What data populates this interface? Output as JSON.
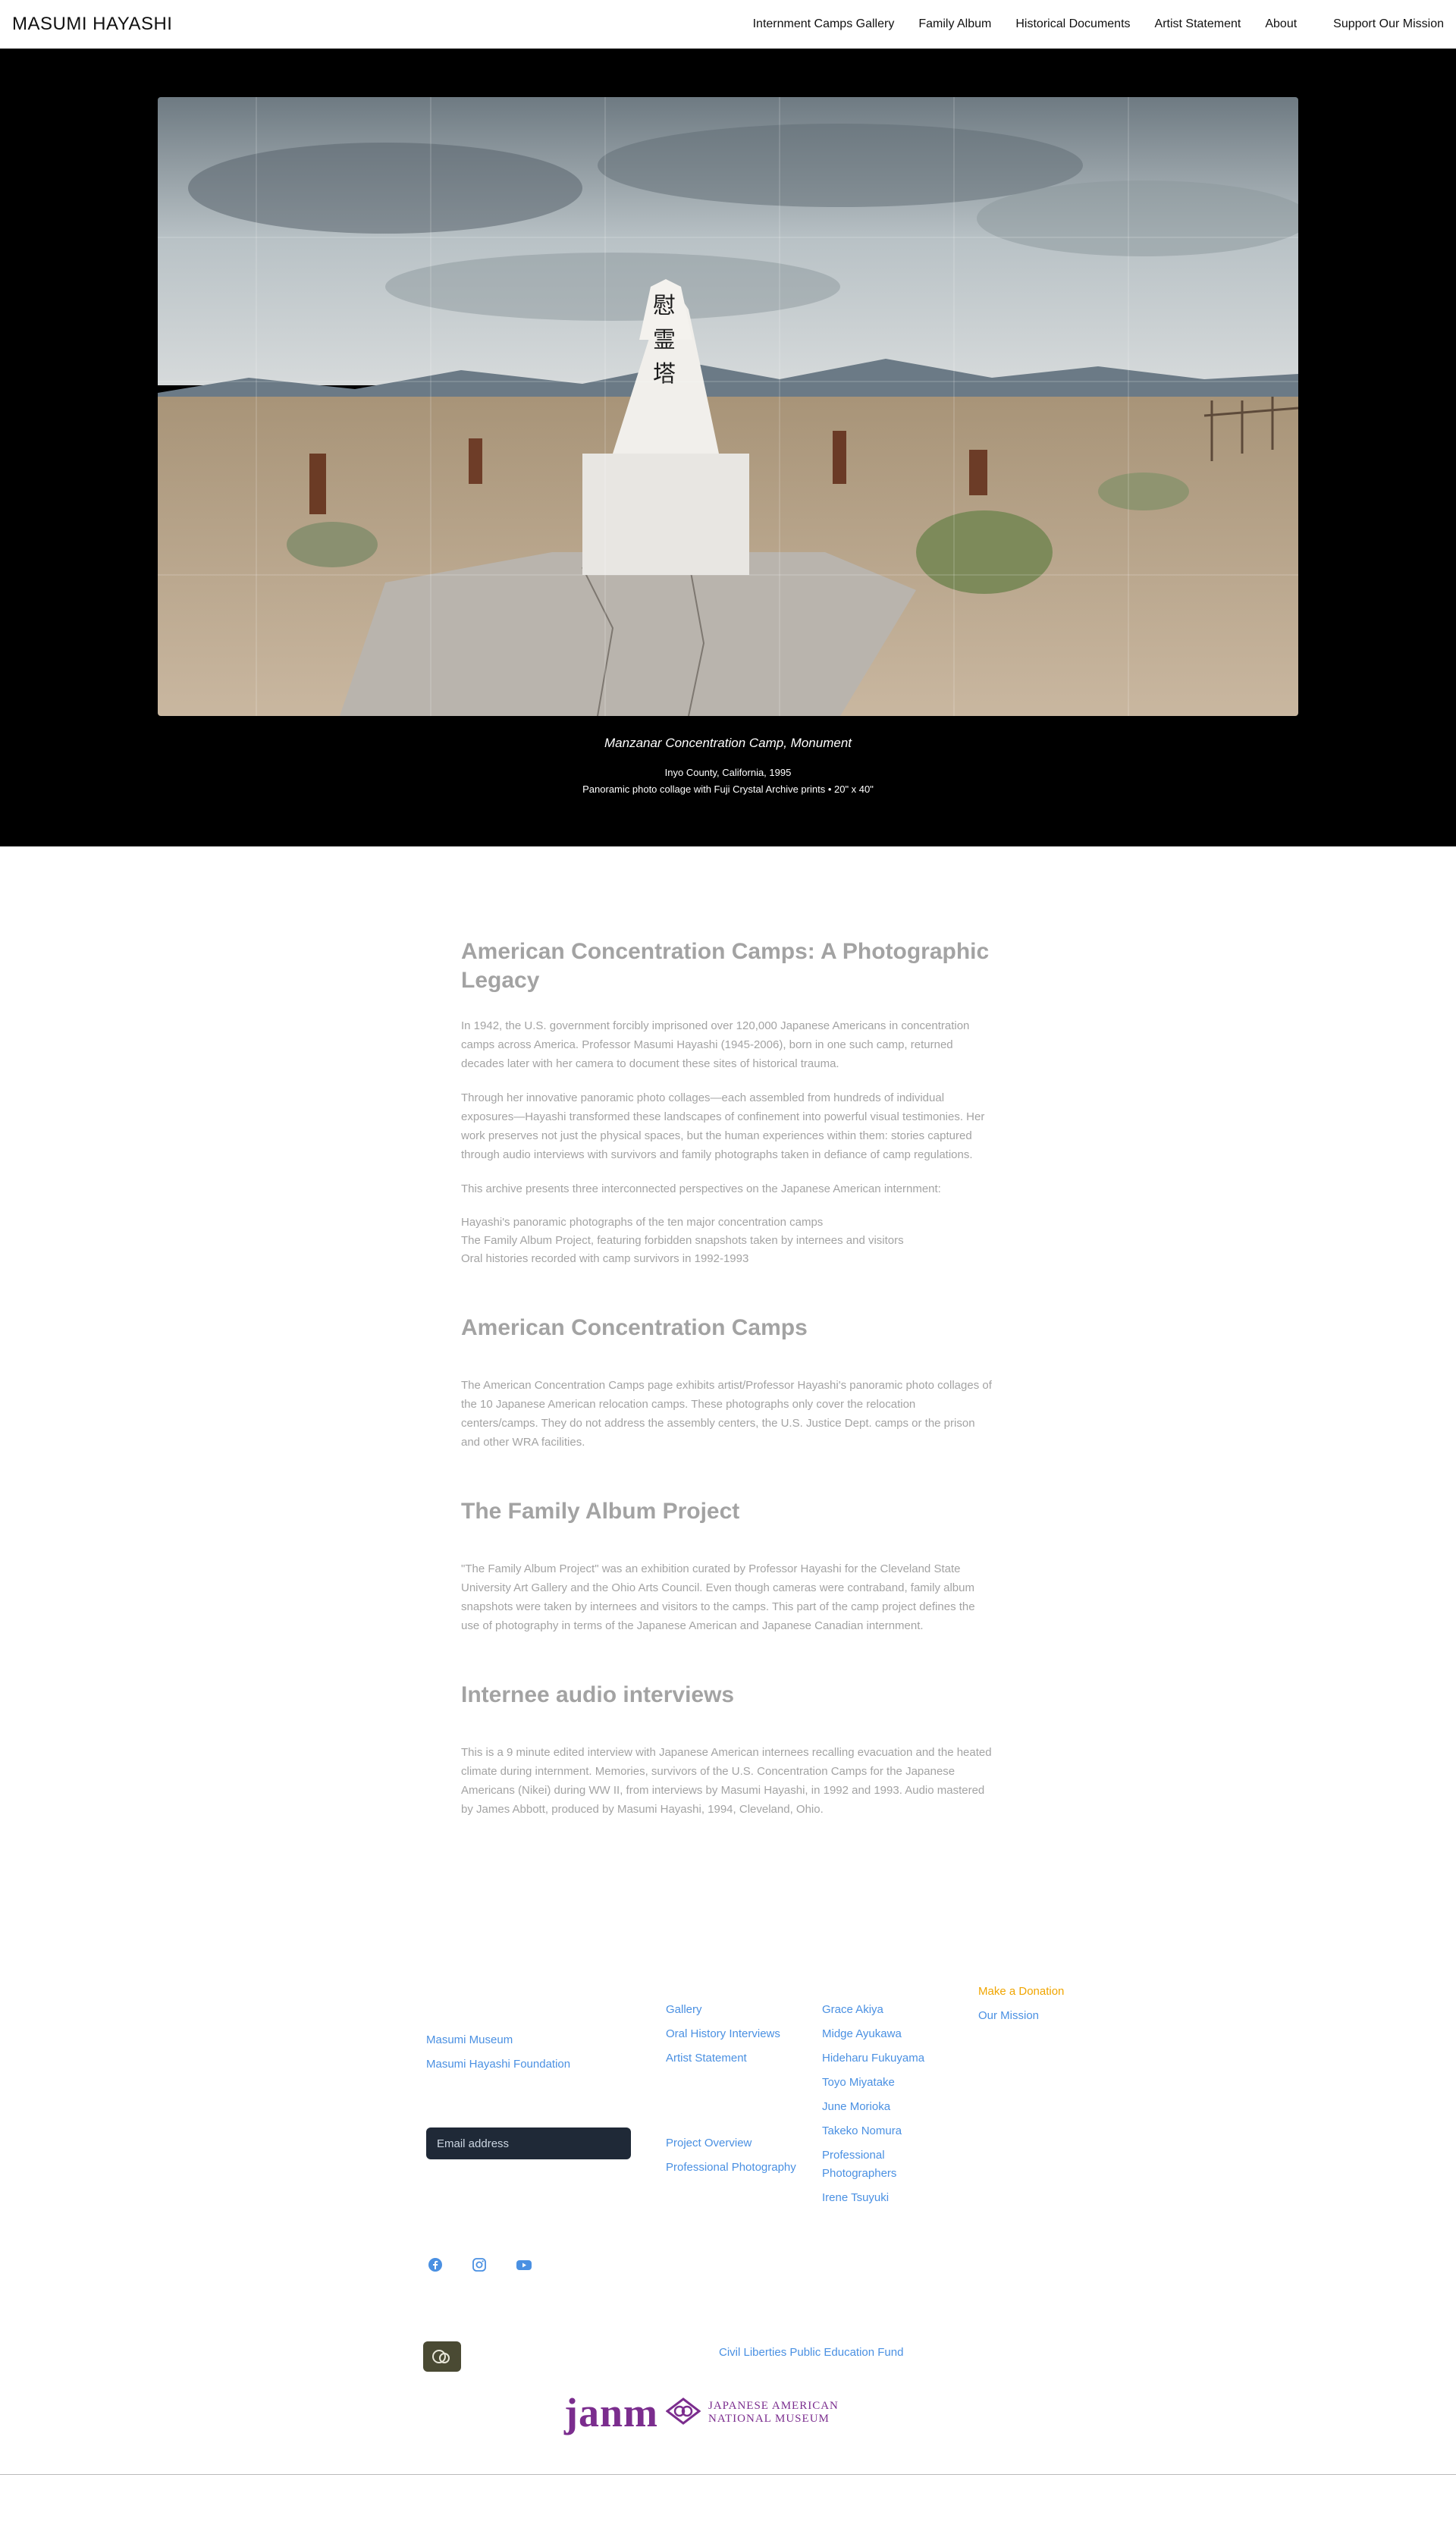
{
  "header": {
    "brand": "MASUMI HAYASHI",
    "nav": [
      "Internment Camps Gallery",
      "Family Album",
      "Historical Documents",
      "Artist Statement",
      "About"
    ],
    "support": "Support Our Mission"
  },
  "hero": {
    "title": "Manzanar Concentration Camp, Monument",
    "location": "Inyo County, California, 1995",
    "medium": "Panoramic photo collage with Fuji Crystal Archive prints • 20\" x 40\"",
    "monument_glyphs": [
      "慰",
      "霊",
      "塔"
    ]
  },
  "content": {
    "intro": {
      "title": "American Concentration Camps: A Photographic Legacy",
      "p1": "In 1942, the U.S. government forcibly imprisoned over 120,000 Japanese Americans in concentration camps across America. Professor Masumi Hayashi (1945-2006), born in one such camp, returned decades later with her camera to document these sites of historical trauma.",
      "p2": "Through her innovative panoramic photo collages—each assembled from hundreds of individual exposures—Hayashi transformed these landscapes of confinement into powerful visual testimonies. Her work preserves not just the physical spaces, but the human experiences within them: stories captured through audio interviews with survivors and family photographs taken in defiance of camp regulations.",
      "p3": "This archive presents three interconnected perspectives on the Japanese American internment:",
      "list": [
        "Hayashi's panoramic photographs of the ten major concentration camps",
        "The Family Album Project, featuring forbidden snapshots taken by internees and visitors",
        "Oral histories recorded with camp survivors in 1992-1993"
      ]
    },
    "camps": {
      "title": "American Concentration Camps",
      "body": "The American Concentration Camps page exhibits artist/Professor Hayashi's panoramic photo collages of the 10 Japanese American relocation camps. These photographs only cover the relocation centers/camps. They do not address the assembly centers, the U.S. Justice Dept. camps or the prison and other WRA facilities."
    },
    "album": {
      "title": "The Family Album Project",
      "body": "\"The Family Album Project\" was an exhibition curated by Professor Hayashi for the Cleveland State University Art Gallery and the Ohio Arts Council. Even though cameras were contraband, family album snapshots were taken by internees and visitors to the camps. This part of the camp project defines the use of photography in terms of the Japanese American and Japanese Canadian internment."
    },
    "audio": {
      "title": "Internee audio interviews",
      "body": "This is a 9 minute edited interview with Japanese American internees recalling evacuation and the heated climate during internment. Memories, survivors of the U.S. Concentration Camps for the Japanese Americans (Nikei) during WW II, from interviews by Masumi Hayashi, in 1992 and 1993. Audio mastered by James Abbott, produced by Masumi Hayashi, 1994, Cleveland, Ohio."
    }
  },
  "footer": {
    "col1": [
      "Masumi Museum",
      "Masumi Hayashi Foundation"
    ],
    "email_placeholder": "Email address",
    "col2a": [
      "Gallery",
      "Oral History Interviews",
      "Artist Statement"
    ],
    "col2b": [
      "Project Overview",
      "Professional Photography"
    ],
    "col3": [
      "Grace Akiya",
      "Midge Ayukawa",
      "Hideharu Fukuyama",
      "Toyo Miyatake",
      "June Morioka",
      "Takeko Nomura",
      "Professional Photographers",
      "Irene Tsuyuki"
    ],
    "col4": [
      "Make a Donation",
      "Our Mission"
    ],
    "social_icons": [
      "facebook-icon",
      "instagram-icon",
      "youtube-icon"
    ],
    "clpef": "Civil Liberties Public Education Fund",
    "janm": {
      "word": "janm",
      "line1": "JAPANESE AMERICAN",
      "line2": "NATIONAL MUSEUM"
    },
    "colors": {
      "link": "#4a90e2",
      "donate": "#f0a500",
      "janm": "#7b2d8e"
    }
  }
}
